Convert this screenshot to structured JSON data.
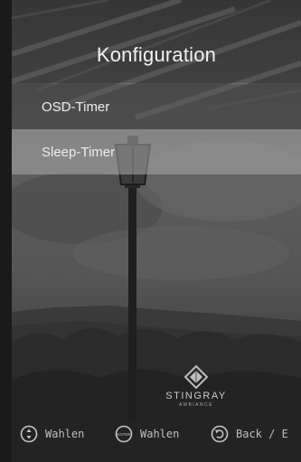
{
  "screen": {
    "title": "Konfiguration"
  },
  "menu": {
    "items": [
      {
        "label": "OSD-Timer",
        "selected": false
      },
      {
        "label": "Sleep-Timer",
        "selected": true
      }
    ]
  },
  "brand": {
    "name": "STINGRAY",
    "sub": "AMBIANCE"
  },
  "footer": {
    "hints": [
      {
        "icon": "up-down-navigation-icon",
        "label": "Wahlen"
      },
      {
        "icon": "enter-button-icon",
        "label": "Wahlen",
        "icon_text": "ENTER"
      },
      {
        "icon": "back-arrow-icon",
        "label": "Back / E"
      }
    ]
  }
}
